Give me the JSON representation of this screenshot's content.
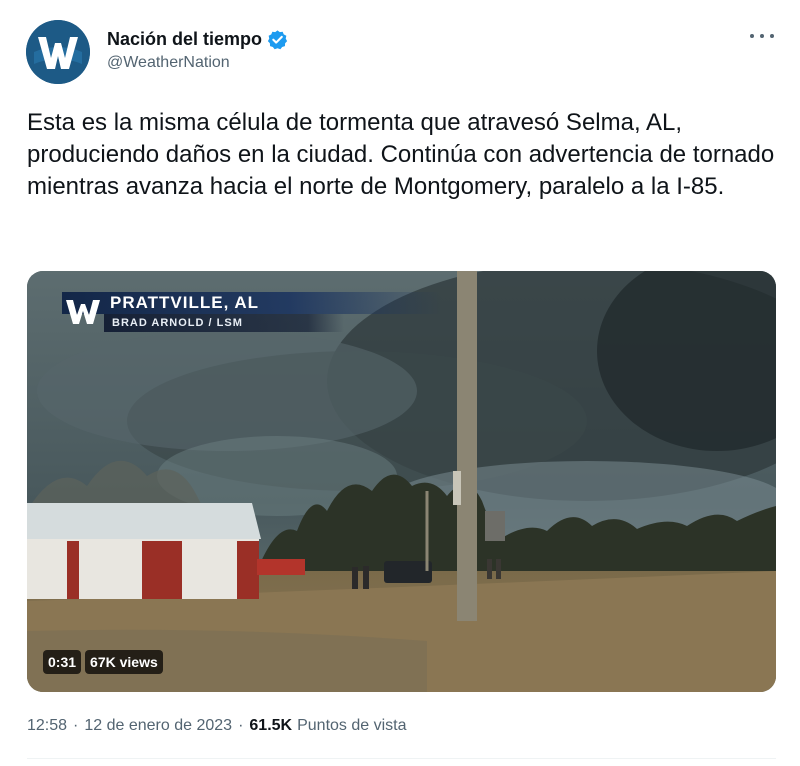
{
  "author": {
    "display_name": "Nación del tiempo",
    "handle": "@WeatherNation",
    "avatar_icon": "weathernation-logo-icon",
    "verified_icon": "verified-badge-icon"
  },
  "menu": {
    "icon": "more-options-icon"
  },
  "tweet": {
    "text": "Esta es la misma célula de tormenta que atravesó Selma, AL, produciendo daños en la ciudad. Continúa con advertencia de tornado mientras avanza hacia el norte de Montgomery, paralelo a la I-85."
  },
  "video": {
    "overlay_city": "PRATTVILLE, AL",
    "overlay_credit": "BRAD ARNOLD / LSM",
    "duration": "0:31",
    "views_badge": "67K views"
  },
  "meta": {
    "time": "12:58",
    "separator": "·",
    "date": "12 de enero de 2023",
    "views_count": "61.5K",
    "views_label": "Puntos de vista"
  },
  "colors": {
    "brand_blue": "#1d9bf0",
    "avatar_bg": "#1d5a86",
    "text_primary": "#0f1419",
    "text_secondary": "#536471"
  }
}
